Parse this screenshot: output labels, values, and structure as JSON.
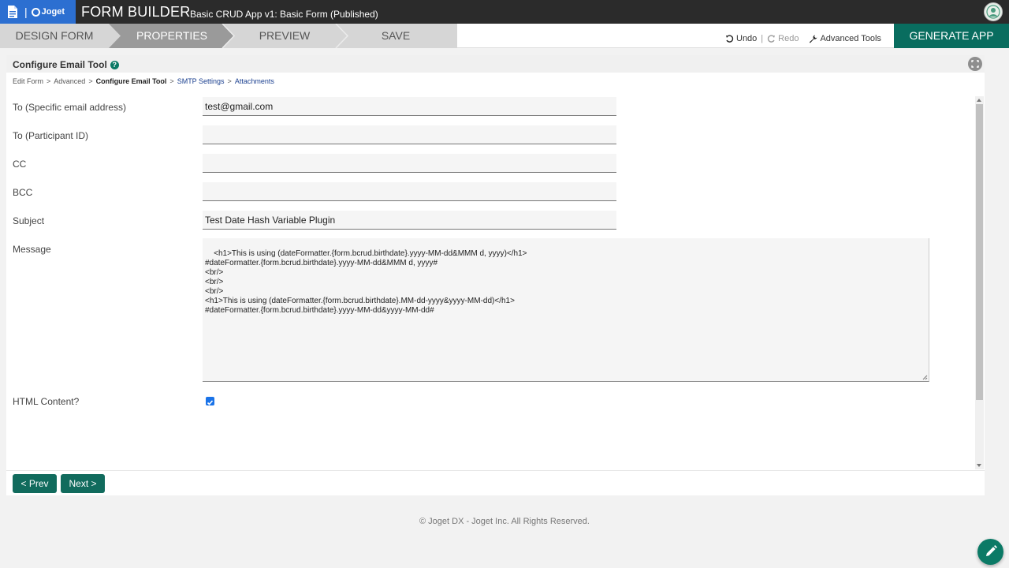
{
  "header": {
    "brand": "Joget",
    "separator": "|",
    "title": "FORM BUILDER",
    "subtitle": "Basic CRUD App v1: Basic Form (Published)"
  },
  "nav": {
    "steps": [
      "DESIGN FORM",
      "PROPERTIES",
      "PREVIEW",
      "SAVE"
    ],
    "active_step": "PROPERTIES",
    "undo_label": "Undo",
    "separator": "|",
    "redo_label": "Redo",
    "advanced_label": "Advanced Tools",
    "generate_label": "GENERATE APP"
  },
  "panel": {
    "title": "Configure Email Tool",
    "breadcrumb": [
      {
        "label": "Edit Form",
        "sep": ">"
      },
      {
        "label": "Advanced",
        "sep": ">"
      },
      {
        "label": "Configure Email Tool",
        "sep": ">"
      },
      {
        "label": "SMTP Settings",
        "sep": ">"
      },
      {
        "label": "Attachments",
        "sep": ""
      }
    ],
    "fields": {
      "to_email": {
        "label": "To (Specific email address)",
        "value": "test@gmail.com"
      },
      "to_participant": {
        "label": "To (Participant ID)",
        "value": ""
      },
      "cc": {
        "label": "CC",
        "value": ""
      },
      "bcc": {
        "label": "BCC",
        "value": ""
      },
      "subject": {
        "label": "Subject",
        "value": "Test Date Hash Variable Plugin"
      },
      "message": {
        "label": "Message",
        "value": "<h1>This is using (dateFormatter.{form.bcrud.birthdate}.yyyy-MM-dd&MMM d, yyyy)</h1>\n#dateFormatter.{form.bcrud.birthdate}.yyyy-MM-dd&MMM d, yyyy#\n<br/>\n<br/>\n<br/>\n<h1>This is using (dateFormatter.{form.bcrud.birthdate}.MM-dd-yyyy&yyyy-MM-dd)</h1>\n#dateFormatter.{form.bcrud.birthdate}.yyyy-MM-dd&yyyy-MM-dd#"
      },
      "html_content": {
        "label": "HTML Content?",
        "checked": true
      }
    },
    "prev_label": "< Prev",
    "next_label": "Next >"
  },
  "footer": {
    "text": "© Joget DX - Joget Inc. All Rights Reserved."
  },
  "colors": {
    "brand_blue": "#2c6fd1",
    "primary_green": "#096d5f",
    "topbar": "#2b2b2b"
  },
  "icons": [
    "document-icon",
    "joget-logo-icon",
    "user-avatar-icon",
    "undo-icon",
    "redo-icon",
    "wrench-icon",
    "help-icon",
    "expand-icon",
    "checkbox-icon",
    "pencil-icon"
  ]
}
